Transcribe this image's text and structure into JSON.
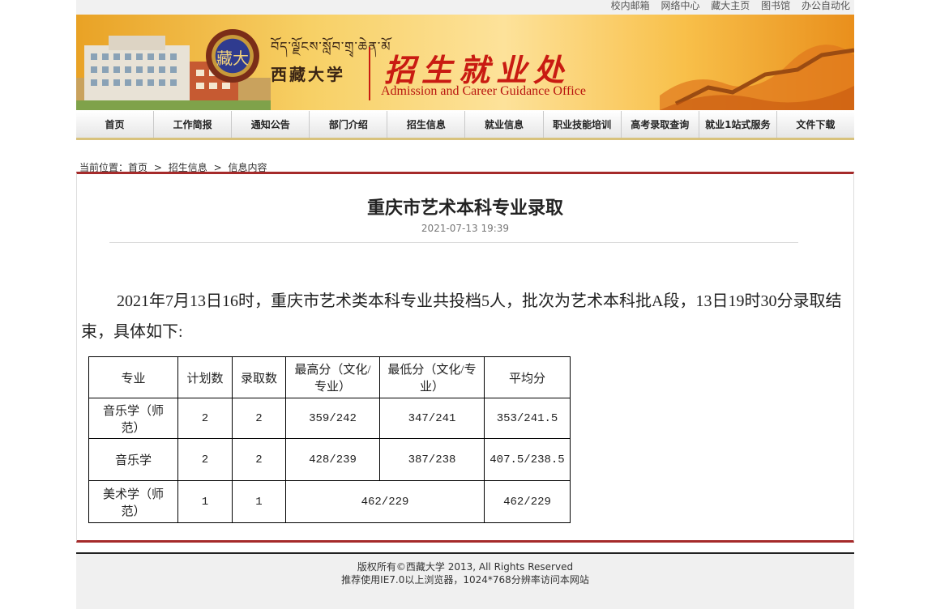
{
  "top_links": [
    "校内邮箱",
    "网络中心",
    "藏大主页",
    "图书馆",
    "办公自动化"
  ],
  "header": {
    "seal_char": "藏大",
    "tibetan_name": "བོད་ལྗོངས་སློབ་གྲྭ་ཆེན་མོ",
    "university_name": "西藏大学",
    "office_cn": "招生就业处",
    "office_en": "Admission and Career Guidance Office"
  },
  "nav": [
    "首页",
    "工作简报",
    "通知公告",
    "部门介绍",
    "招生信息",
    "就业信息",
    "职业技能培训",
    "高考录取查询",
    "就业1站式服务",
    "文件下载"
  ],
  "breadcrumb": {
    "prefix": "当前位置：",
    "items": [
      "首页",
      "招生信息",
      "信息内容"
    ],
    "separator": ">"
  },
  "article": {
    "title": "重庆市艺术本科专业录取",
    "date": "2021-07-13 19:39",
    "paragraph": "2021年7月13日16时，重庆市艺术类本科专业共投档5人，批次为艺术本科批A段，13日19时30分录取结束，具体如下:",
    "table": {
      "headers": [
        "专业",
        "计划数",
        "录取数",
        "最高分（文化/专业）",
        "最低分（文化/专业）",
        "平均分"
      ],
      "rows": [
        [
          "音乐学（师范）",
          "2",
          "2",
          "359/242",
          "347/241",
          "353/241.5"
        ],
        [
          "音乐学",
          "2",
          "2",
          "428/239",
          "387/238",
          "407.5/238.5"
        ],
        [
          "美术学（师范）",
          "1",
          "1",
          "462/229",
          "",
          "462/229"
        ]
      ]
    }
  },
  "footer": {
    "line1": "版权所有©西藏大学 2013, All Rights Reserved",
    "line2": "推荐使用IE7.0以上浏览器，1024*768分辨率访问本网站"
  }
}
